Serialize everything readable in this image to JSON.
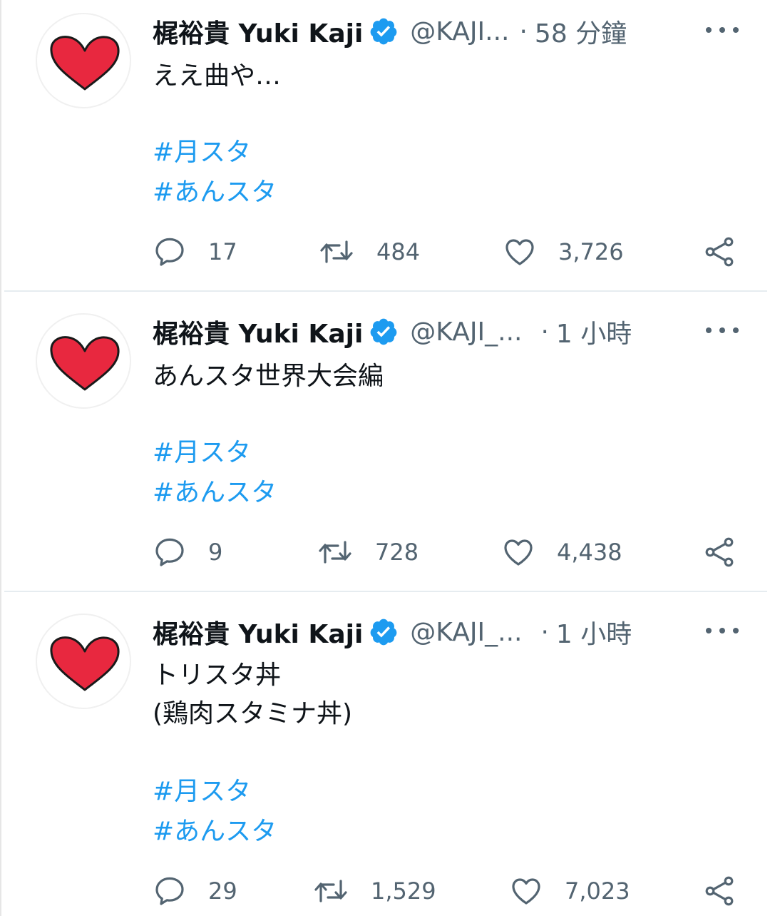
{
  "colors": {
    "link": "#1d9bf0",
    "secondary": "#536471",
    "heart_avatar": "#e8283f",
    "verified": "#1d9bf0"
  },
  "tweets": [
    {
      "name": "梶裕貴 Yuki Kaji",
      "handle": "@KAJI...",
      "dot": "·",
      "time": "58 分鐘",
      "text": "ええ曲や…",
      "hashtags": [
        "#月スタ",
        "#あんスタ"
      ],
      "reply_count": "17",
      "retweet_count": "484",
      "like_count": "3,726"
    },
    {
      "name": "梶裕貴 Yuki Kaji",
      "handle": "@KAJI_...",
      "dot": "·",
      "time": "1 小時",
      "text": "あんスタ世界大会編",
      "hashtags": [
        "#月スタ",
        "#あんスタ"
      ],
      "reply_count": "9",
      "retweet_count": "728",
      "like_count": "4,438"
    },
    {
      "name": "梶裕貴 Yuki Kaji",
      "handle": "@KAJI_...",
      "dot": "·",
      "time": "1 小時",
      "text": "トリスタ丼\n(鶏肉スタミナ丼)",
      "hashtags": [
        "#月スタ",
        "#あんスタ"
      ],
      "reply_count": "29",
      "retweet_count": "1,529",
      "like_count": "7,023"
    }
  ],
  "icons": [
    "heart-avatar-icon",
    "verified-badge-icon",
    "more-icon",
    "reply-icon",
    "retweet-icon",
    "like-icon",
    "share-icon"
  ]
}
